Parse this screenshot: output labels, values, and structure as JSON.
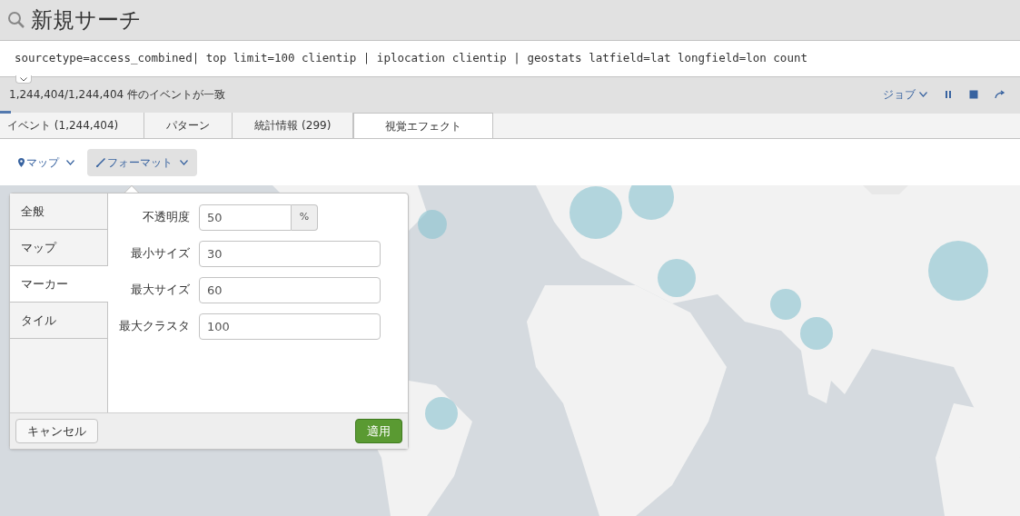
{
  "search": {
    "title": "新規サーチ",
    "query": "sourcetype=access_combined| top limit=100 clientip | iplocation clientip | geostats latfield=lat longfield=lon count"
  },
  "query_expanded": false,
  "status": {
    "event_count": "1,244,404/1,244,404 件のイベントが一致",
    "job_menu": "ジョブ"
  },
  "tabs": [
    {
      "label": "イベント (1,244,404)",
      "selected": false
    },
    {
      "label": "パターン",
      "selected": false
    },
    {
      "label": "統計情報 (299)",
      "selected": false
    },
    {
      "label": "視覚エフェクト",
      "selected": true
    }
  ],
  "viz_toolbar": [
    {
      "kind": "map",
      "label": "マップ",
      "selected": false
    },
    {
      "kind": "format",
      "label": "フォーマット",
      "selected": true
    }
  ],
  "format_panel": {
    "sections": [
      {
        "label": "全般",
        "selected": false
      },
      {
        "label": "マップ",
        "selected": false
      },
      {
        "label": "マーカー",
        "selected": true
      },
      {
        "label": "タイル",
        "selected": false
      }
    ],
    "fields": [
      {
        "label": "不透明度",
        "value": "50",
        "suffix": "%"
      },
      {
        "label": "最小サイズ",
        "value": "30"
      },
      {
        "label": "最大サイズ",
        "value": "60"
      },
      {
        "label": "最大クラスタ",
        "value": "100"
      }
    ],
    "cancel": "キャンセル",
    "apply": "適用"
  }
}
